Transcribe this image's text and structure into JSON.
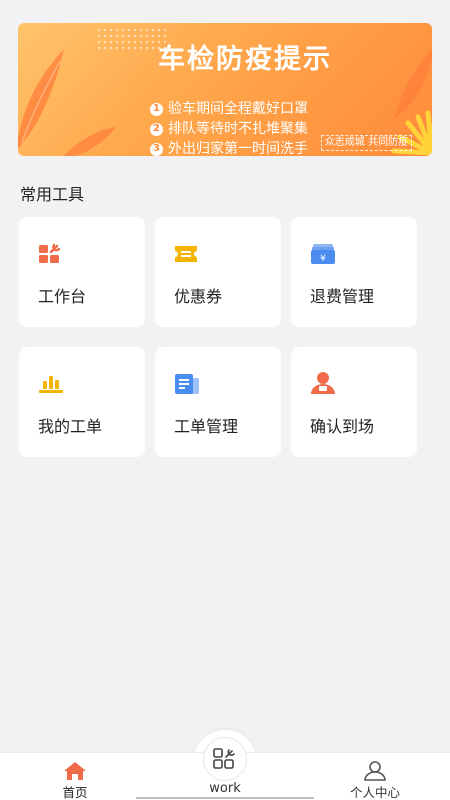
{
  "banner": {
    "title": "车检防疫提示",
    "tips": [
      {
        "num": "1",
        "text": "验车期间全程戴好口罩"
      },
      {
        "num": "2",
        "text": "排队等待时不扎堆聚集"
      },
      {
        "num": "3",
        "text": "外出归家第一时间洗手"
      }
    ],
    "slogan": "众志成城 共同防疫"
  },
  "section_title": "常用工具",
  "tools": [
    {
      "label": "工作台",
      "icon": "workbench-icon",
      "color": "#ef6b4a"
    },
    {
      "label": "优惠券",
      "icon": "coupon-icon",
      "color": "#f5b400"
    },
    {
      "label": "退费管理",
      "icon": "refund-icon",
      "color": "#4a8cf0"
    },
    {
      "label": "我的工单",
      "icon": "my-orders-icon",
      "color": "#f5b400"
    },
    {
      "label": "工单管理",
      "icon": "order-management-icon",
      "color": "#4a8cf0"
    },
    {
      "label": "确认到场",
      "icon": "confirm-arrival-icon",
      "color": "#ef6b4a"
    }
  ],
  "tabbar": {
    "home": "首页",
    "work": "work",
    "profile": "个人中心"
  },
  "colors": {
    "accent": "#ef6b4a",
    "banner": "#ffa64a",
    "background": "#f2f2f4"
  }
}
